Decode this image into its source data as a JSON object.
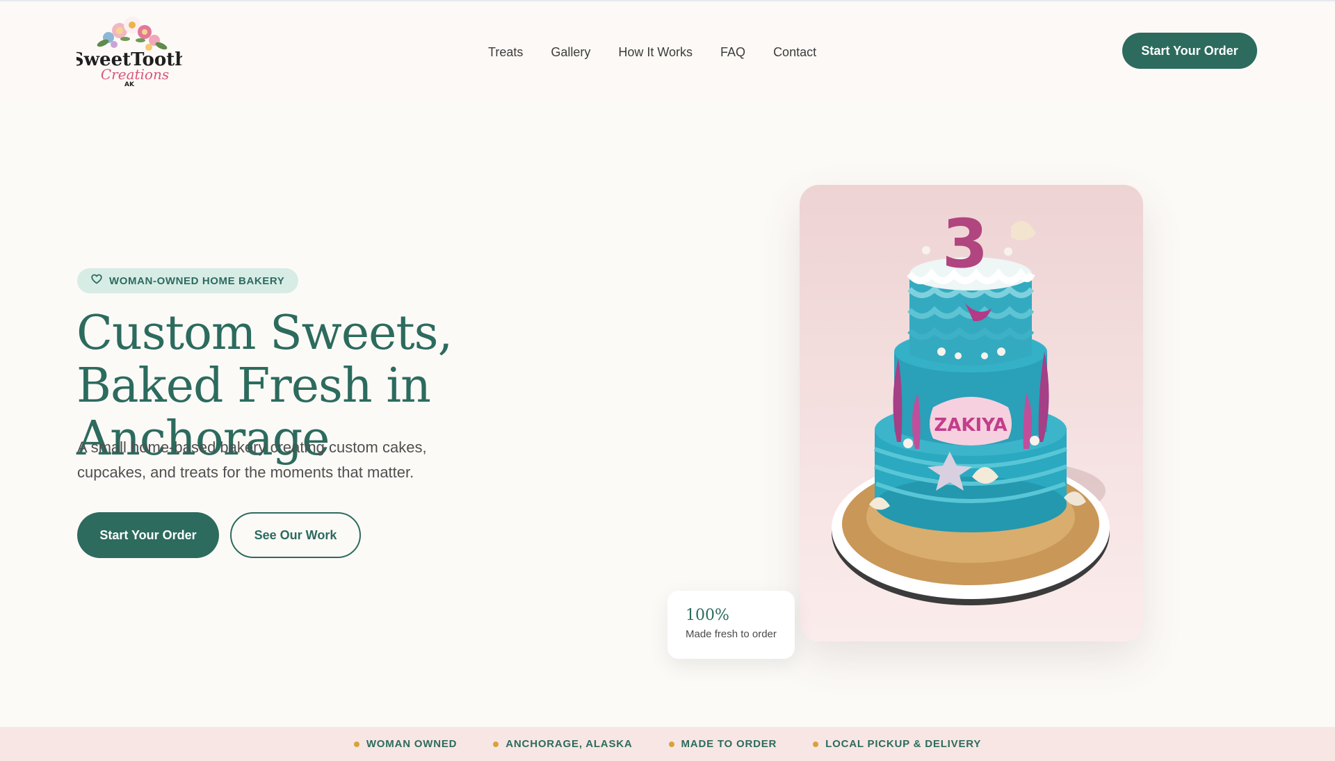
{
  "brand": {
    "logo_text": "SweetTooth",
    "logo_script": "Creations",
    "logo_region": "AK"
  },
  "nav": {
    "items": [
      "Treats",
      "Gallery",
      "How It Works",
      "FAQ",
      "Contact"
    ],
    "cta_label": "Start Your Order"
  },
  "hero": {
    "badge_icon": "heart-outline-icon",
    "badge_label": "WOMAN-OWNED HOME BAKERY",
    "title": "Custom Sweets, Baked Fresh in Anchorage",
    "subtitle": "A small home-based bakery creating custom cakes, cupcakes, and treats for the moments that matter.",
    "primary_cta": "Start Your Order",
    "secondary_cta": "See Our Work",
    "stat_value": "100%",
    "stat_label": "Made fresh to order",
    "cake_topper_number": "3",
    "cake_name": "ZAKIYA"
  },
  "strip": {
    "items": [
      "WOMAN OWNED",
      "ANCHORAGE, ALASKA",
      "MADE TO ORDER",
      "LOCAL PICKUP & DELIVERY"
    ]
  },
  "colors": {
    "primary": "#2c6b5e",
    "badge_bg": "#d8ece6",
    "strip_bg": "#f7e6e3",
    "strip_dot": "#d8a13b",
    "page_bg": "#fcfaf7"
  }
}
